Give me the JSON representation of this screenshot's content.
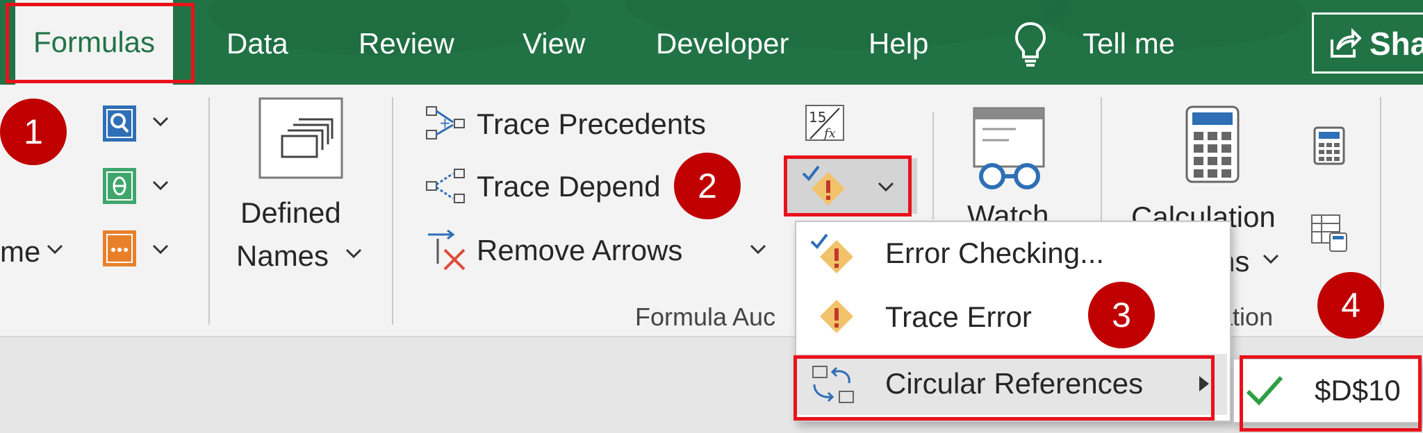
{
  "tabs": {
    "formulas": "Formulas",
    "data": "Data",
    "review": "Review",
    "view": "View",
    "developer": "Developer",
    "help": "Help",
    "tell_me": "Tell me",
    "share": "Sha"
  },
  "ribbon": {
    "name_manager_partial": "me",
    "defined_names_line1": "Defined",
    "defined_names_line2": "Names",
    "trace_precedents": "Trace Precedents",
    "trace_dependents": "Trace Depend",
    "remove_arrows": "Remove Arrows",
    "watch_window": "Watch",
    "calculation_options_line1": "Calculation",
    "calculation_options_line2": "ns",
    "group_formula_auditing": "Formula Auc",
    "group_calculation": "ulation"
  },
  "error_menu": {
    "error_checking": "Error Checking...",
    "trace_error": "Trace Error",
    "circular_references": "Circular References"
  },
  "submenu": {
    "cell_ref": "$D$10"
  },
  "badges": [
    "1",
    "2",
    "3",
    "4"
  ],
  "colors": {
    "tab_bar": "#217346",
    "highlight": "#e8121b",
    "badge": "#c00000"
  }
}
